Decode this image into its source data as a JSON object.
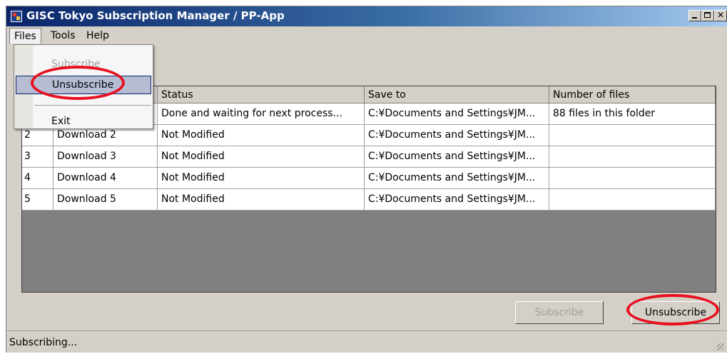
{
  "window": {
    "title": "GISC Tokyo Subscription Manager / PP-App",
    "app_icon": "app-icon"
  },
  "menubar": {
    "files": "Files",
    "tools": "Tools",
    "help": "Help"
  },
  "files_menu": {
    "subscribe": "Subscribe",
    "unsubscribe": "Unsubscribe",
    "exit": "Exit"
  },
  "grid": {
    "columns": [
      "",
      "",
      "Status",
      "Save to",
      "Number of files"
    ],
    "rows": [
      {
        "num": "",
        "name": "",
        "status": "Done and waiting for next process...",
        "save_to": "C:¥Documents and Settings¥JM...",
        "files": "88 files in this folder"
      },
      {
        "num": "2",
        "name": "Download 2",
        "status": "Not Modified",
        "save_to": "C:¥Documents and Settings¥JM...",
        "files": ""
      },
      {
        "num": "3",
        "name": "Download 3",
        "status": "Not Modified",
        "save_to": "C:¥Documents and Settings¥JM...",
        "files": ""
      },
      {
        "num": "4",
        "name": "Download 4",
        "status": "Not Modified",
        "save_to": "C:¥Documents and Settings¥JM...",
        "files": ""
      },
      {
        "num": "5",
        "name": "Download 5",
        "status": "Not Modified",
        "save_to": "C:¥Documents and Settings¥JM...",
        "files": ""
      }
    ]
  },
  "buttons": {
    "subscribe": "Subscribe",
    "unsubscribe": "Unsubscribe"
  },
  "status": {
    "text": "Subscribing..."
  },
  "colors": {
    "annotation": "#e8101e",
    "titlebar_start": "#0a246a",
    "titlebar_end": "#a6caf0"
  }
}
